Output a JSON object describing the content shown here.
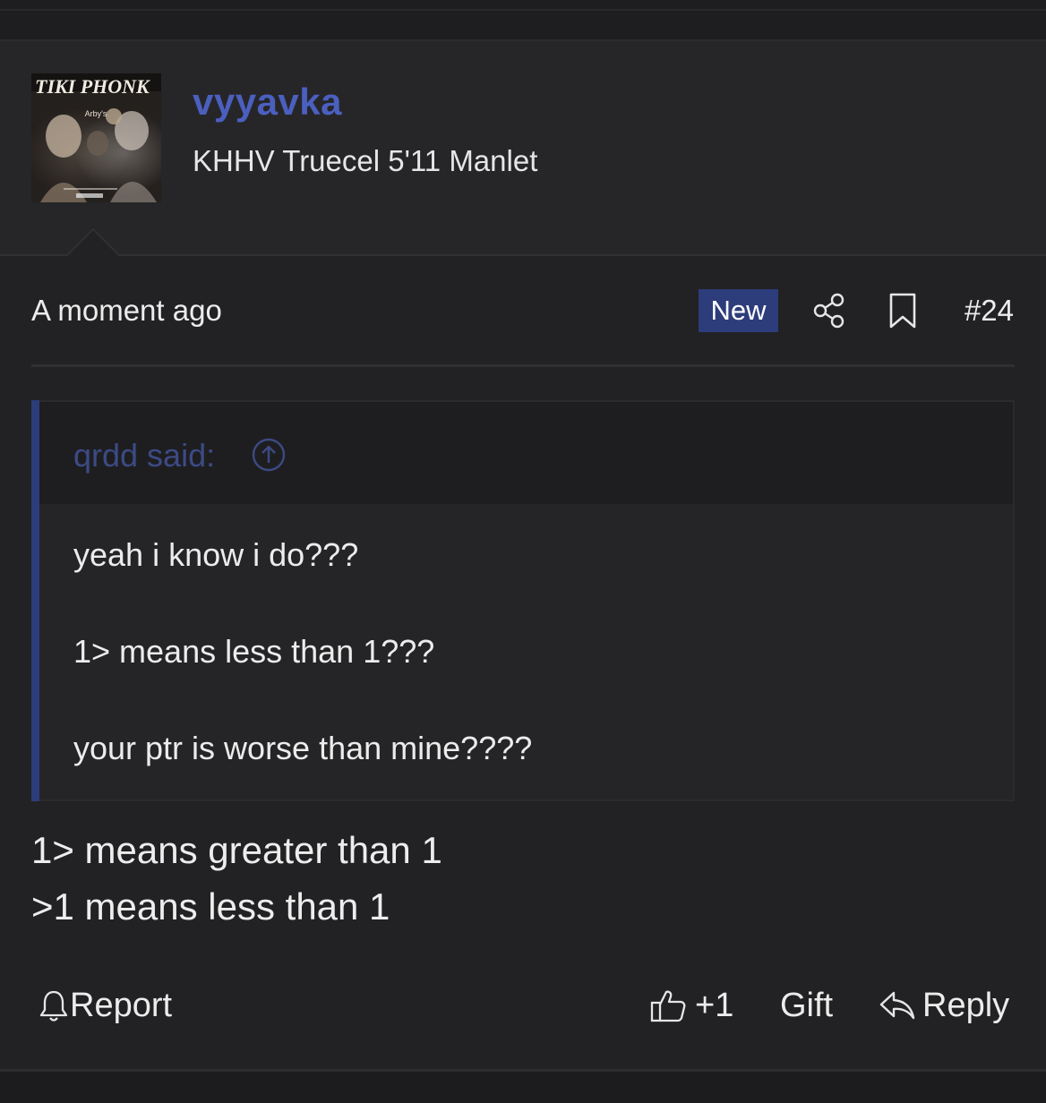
{
  "post": {
    "author": {
      "username": "vyyavka",
      "title": "KHHV Truecel 5'11 Manlet",
      "avatar_text": "TIKI PHONK"
    },
    "meta": {
      "timestamp": "A moment ago",
      "badge": "New",
      "post_number": "#24"
    },
    "quote": {
      "author_label": "qrdd said:",
      "lines": [
        "yeah i know i do???",
        "1> means less than 1???",
        "your ptr is worse than mine????"
      ]
    },
    "body": [
      "1> means greater than 1",
      ">1 means less than 1"
    ],
    "actions": {
      "report": "Report",
      "reaction": "+1",
      "gift": "Gift",
      "reply": "Reply"
    }
  },
  "icons": {
    "share": "share-icon",
    "bookmark": "bookmark-icon",
    "quote_jump": "arrow-up-circle-icon",
    "report": "bell-icon",
    "reaction": "thumbs-up-icon",
    "reply": "reply-arrow-icon"
  },
  "colors": {
    "background": "#222224",
    "username": "#4b5fbf",
    "badge": "#2d3c7a",
    "quote_bar": "#2d3c7a",
    "quote_author": "#3c4a85"
  }
}
